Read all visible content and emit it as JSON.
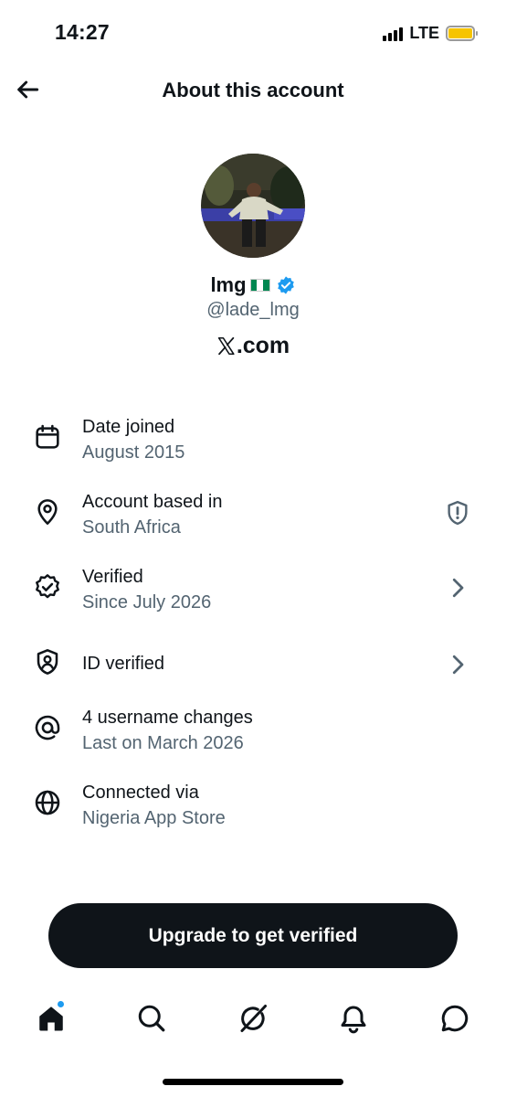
{
  "status_bar": {
    "time": "14:27",
    "network": "LTE",
    "battery_color": "#f6c400"
  },
  "header": {
    "back_icon": "arrow-left-icon",
    "title": "About this account"
  },
  "profile": {
    "display_name": "lmg",
    "flag": "Nigeria flag",
    "verified_badge_color": "#1d9bf0",
    "handle": "@lade_lmg",
    "site": ".com",
    "site_logo": "x-logo-icon"
  },
  "info_items": [
    {
      "icon": "calendar-icon",
      "title": "Date joined",
      "subtitle": "August 2015"
    },
    {
      "icon": "location-pin-icon",
      "title": "Account based in",
      "subtitle": "South Africa",
      "action_icon": "shield-alert-icon"
    },
    {
      "icon": "verified-badge-icon",
      "title": "Verified",
      "subtitle": "Since July 2026",
      "action_icon": "chevron-right-icon"
    },
    {
      "icon": "id-shield-icon",
      "title": "ID verified",
      "action_icon": "chevron-right-icon"
    },
    {
      "icon": "at-sign-icon",
      "title": "4 username changes",
      "subtitle": "Last on March 2026"
    },
    {
      "icon": "globe-icon",
      "title": "Connected via",
      "subtitle": "Nigeria App Store"
    }
  ],
  "upgrade_button": {
    "label": "Upgrade to get verified"
  },
  "tab_bar": {
    "tabs": [
      "home-icon",
      "search-icon",
      "grok-icon",
      "bell-icon",
      "chat-bubble-icon"
    ],
    "active": "home-icon",
    "notification_dot_color": "#1d9bf0"
  }
}
